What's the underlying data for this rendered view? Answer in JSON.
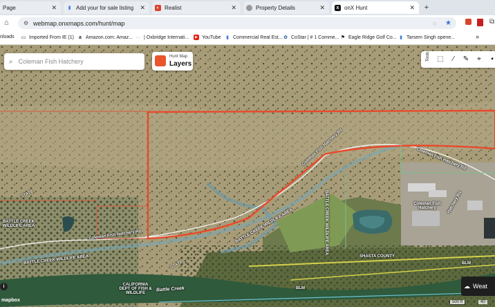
{
  "tabs": [
    {
      "label": "Page",
      "icon": "page-icon",
      "color": "#4b6cb7"
    },
    {
      "label": "Add your for sale listing",
      "icon": "bars-icon",
      "color": "#3f7fd4"
    },
    {
      "label": "Realist",
      "icon": "realist-icon",
      "color": "#d8452d"
    },
    {
      "label": "Property Details",
      "icon": "globe-icon",
      "color": "#888888"
    },
    {
      "label": "onX Hunt",
      "icon": "onx-icon",
      "color": "#111111"
    }
  ],
  "new_tab": "+",
  "address": {
    "url": "webmap.onxmaps.com/hunt/map"
  },
  "bookmarks": [
    {
      "label": "nloads",
      "icon": "folder-icon"
    },
    {
      "label": "Imported From IE (1)",
      "icon": "folder-icon"
    },
    {
      "label": "Amazon.com: Amaz...",
      "icon": "amazon-icon"
    },
    {
      "label": "| Oxbridge Internati...",
      "icon": "dots-icon"
    },
    {
      "label": "YouTube",
      "icon": "youtube-icon"
    },
    {
      "label": "Commercial Real Est...",
      "icon": "bars-icon"
    },
    {
      "label": "CoStar | # 1 Comme...",
      "icon": "costar-icon"
    },
    {
      "label": "Eagle Ridge Golf Co...",
      "icon": "golf-icon"
    },
    {
      "label": "Tarsem Singh opene...",
      "icon": "bars-icon"
    }
  ],
  "bookmarks_more": "»",
  "search": {
    "placeholder": "Coleman Fish Hatchery"
  },
  "layers": {
    "small": "Hunt Map",
    "big": "Layers"
  },
  "tools": {
    "label": "Tools"
  },
  "weather": {
    "label": "Weat"
  },
  "mapbox": "mapbox",
  "scale": {
    "a": "500 ft",
    "b": "40"
  },
  "map_labels": {
    "battle_creek_wildlife_area": "BATTLE CREEK WILDLIFE AREA",
    "battle_creek_wildlife_area_2": "BATTLE CREEK WILDLIFE AREA",
    "battle_creek_wildlife_area_3": "BATTLE CREEK WILDLIFE AREA",
    "battle_creek_wildlife_area_4": "BATTLE CREEK WILDLIFE AREA",
    "coleman_fish_hatchery": "Coleman Fish Hatchery",
    "coleman_fish_hatchery_rd": "Coleman Fish Hatchery Rd",
    "coleman_fish_hatchery_rd_2": "Coleman Fish Hatchery Rd",
    "coleman_fish_hatchery_rd_3": "Coleman Fish Hatchery Rd",
    "california_dept": "CALIFORNIA DEPT OF FISH & WILDLIFE",
    "battle_creek": "Battle Creek",
    "shasta_county": "SHASTA COUNTY",
    "blm": "BLM",
    "blm2": "BLM",
    "hatchery_rd": "Hatchery Rd",
    "state": "STATE",
    "state2": "STATE"
  }
}
